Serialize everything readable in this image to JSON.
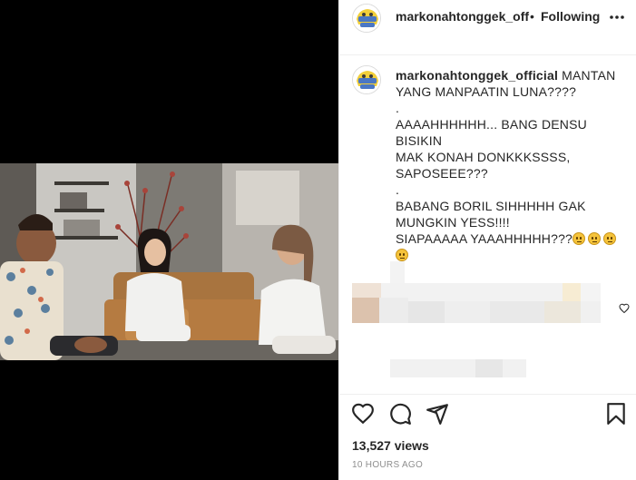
{
  "post": {
    "username": "markonahtonggek_off",
    "separator": "•",
    "follow_status": "Following"
  },
  "caption": {
    "username": "markonahtonggek_official",
    "lines": [
      "MANTAN",
      "YANG MANPAATIN LUNA????",
      ".",
      "AAAAHHHHHH... BANG DENSU BISIKIN",
      "MAK KONAH DONKKKSSSS,",
      "SAPOSEEE???",
      ".",
      "BABANG BORIL SIHHHHH GAK",
      "MUNGKIN YESS!!!!",
      "SIAPAAAAA YAAAHHHHH???"
    ]
  },
  "icons": {
    "more": "more-horizontal-icon",
    "like": "heart-icon",
    "comment": "comment-icon",
    "share": "paper-plane-icon",
    "save": "bookmark-icon",
    "emoji": "rolling-eyes-emoji"
  },
  "stats": {
    "views": "13,527 views",
    "time": "10 HOURS AGO"
  }
}
